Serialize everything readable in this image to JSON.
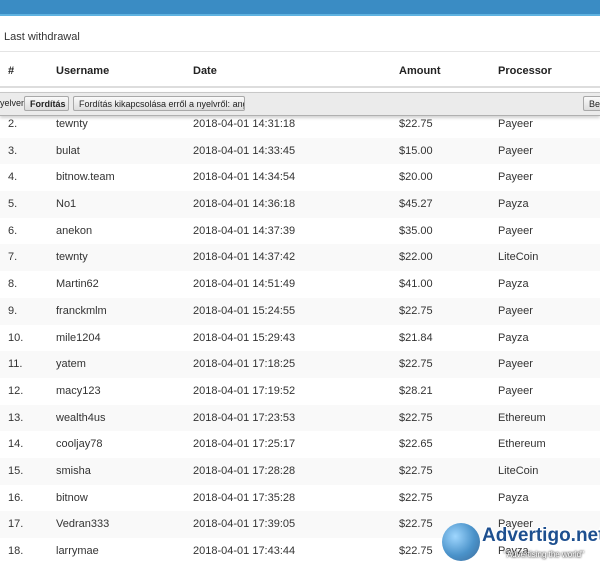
{
  "panel": {
    "title": "Last withdrawal"
  },
  "table": {
    "headers": {
      "num": "#",
      "username": "Username",
      "date": "Date",
      "amount": "Amount",
      "processor": "Processor"
    },
    "rows": [
      {
        "num": "2.",
        "username": "tewnty",
        "date": "2018-04-01 14:31:18",
        "amount": "$22.75",
        "processor": "Payeer"
      },
      {
        "num": "3.",
        "username": "bulat",
        "date": "2018-04-01 14:33:45",
        "amount": "$15.00",
        "processor": "Payeer"
      },
      {
        "num": "4.",
        "username": "bitnow.team",
        "date": "2018-04-01 14:34:54",
        "amount": "$20.00",
        "processor": "Payeer"
      },
      {
        "num": "5.",
        "username": "No1",
        "date": "2018-04-01 14:36:18",
        "amount": "$45.27",
        "processor": "Payza"
      },
      {
        "num": "6.",
        "username": "anekon",
        "date": "2018-04-01 14:37:39",
        "amount": "$35.00",
        "processor": "Payeer"
      },
      {
        "num": "7.",
        "username": "tewnty",
        "date": "2018-04-01 14:37:42",
        "amount": "$22.00",
        "processor": "LiteCoin"
      },
      {
        "num": "8.",
        "username": "Martin62",
        "date": "2018-04-01 14:51:49",
        "amount": "$41.00",
        "processor": "Payza"
      },
      {
        "num": "9.",
        "username": "franckmlm",
        "date": "2018-04-01 15:24:55",
        "amount": "$22.75",
        "processor": "Payeer"
      },
      {
        "num": "10.",
        "username": "mile1204",
        "date": "2018-04-01 15:29:43",
        "amount": "$21.84",
        "processor": "Payza"
      },
      {
        "num": "11.",
        "username": "yatem",
        "date": "2018-04-01 17:18:25",
        "amount": "$22.75",
        "processor": "Payeer"
      },
      {
        "num": "12.",
        "username": "macy123",
        "date": "2018-04-01 17:19:52",
        "amount": "$28.21",
        "processor": "Payeer"
      },
      {
        "num": "13.",
        "username": "wealth4us",
        "date": "2018-04-01 17:23:53",
        "amount": "$22.75",
        "processor": "Ethereum"
      },
      {
        "num": "14.",
        "username": "cooljay78",
        "date": "2018-04-01 17:25:17",
        "amount": "$22.65",
        "processor": "Ethereum"
      },
      {
        "num": "15.",
        "username": "smisha",
        "date": "2018-04-01 17:28:28",
        "amount": "$22.75",
        "processor": "LiteCoin"
      },
      {
        "num": "16.",
        "username": "bitnow",
        "date": "2018-04-01 17:35:28",
        "amount": "$22.75",
        "processor": "Payza"
      },
      {
        "num": "17.",
        "username": "Vedran333",
        "date": "2018-04-01 17:39:05",
        "amount": "$22.75",
        "processor": "Payeer"
      },
      {
        "num": "18.",
        "username": "larrymae",
        "date": "2018-04-01 17:43:44",
        "amount": "$22.75",
        "processor": "Payza"
      }
    ]
  },
  "translate_bar": {
    "lead_text": "yelven",
    "translate_label": "Fordítás",
    "disable_label": "Fordítás kikapcsolása erről a nyelvről: angol",
    "right_label": "Beá"
  },
  "watermark": {
    "brand": "Advertigo.net",
    "tagline": "\"Advertising the world\""
  },
  "colors": {
    "topbar": "#3a8cc4",
    "topbar_accent": "#5fb2e0",
    "row_alt": "#f9f9f9"
  }
}
